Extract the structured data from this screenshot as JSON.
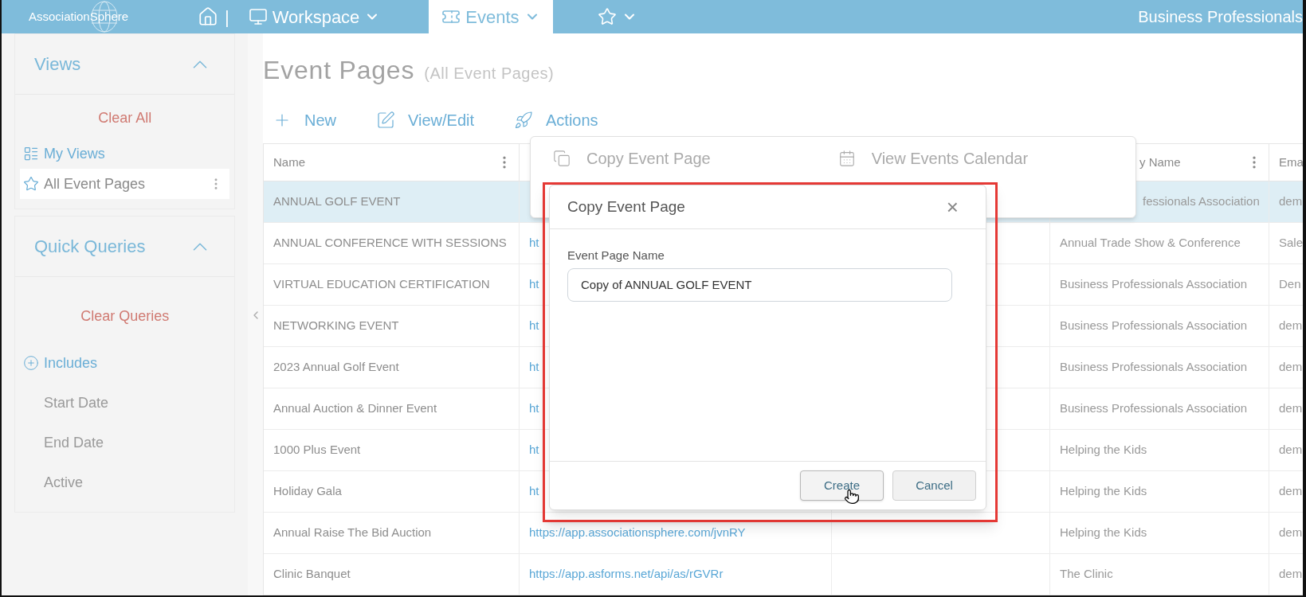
{
  "topbar": {
    "logo": "AssociationSphere",
    "separator": "|",
    "nav": [
      {
        "kind": "workspace",
        "label": "Workspace",
        "selected": false
      },
      {
        "kind": "events",
        "label": "Events",
        "selected": true
      },
      {
        "kind": "favorites",
        "selected": false
      }
    ],
    "organization": "Business Professionals"
  },
  "sidebar": {
    "sections": [
      {
        "title": "Views",
        "expanded": true,
        "clear": "Clear All",
        "items": [
          {
            "kind": "link",
            "label": "My Views",
            "selected": false
          },
          {
            "kind": "view",
            "label": "All Event Pages",
            "selected": true
          }
        ]
      },
      {
        "title": "Quick Queries",
        "expanded": true,
        "clear": "Clear Queries",
        "items": [
          {
            "kind": "add",
            "label": "Includes",
            "selected": false
          },
          {
            "kind": "field",
            "label": "Start Date",
            "selected": false
          },
          {
            "kind": "field",
            "label": "End Date",
            "selected": false
          },
          {
            "kind": "field",
            "label": "Active",
            "selected": false
          }
        ]
      }
    ]
  },
  "page": {
    "title": "Event Pages",
    "subtitle": "(All Event Pages)"
  },
  "toolbar": [
    {
      "kind": "new",
      "label": "New"
    },
    {
      "kind": "edit",
      "label": "View/Edit"
    },
    {
      "kind": "actions",
      "label": "Actions"
    }
  ],
  "actions_menu": [
    {
      "kind": "copy",
      "label": "Copy Event Page"
    },
    {
      "kind": "calendar",
      "label": "View Events Calendar"
    }
  ],
  "table": {
    "columns": [
      {
        "label": "Name",
        "menu": true
      },
      {},
      {},
      {
        "label": "y Name",
        "menu": true,
        "clipped": true
      },
      {
        "label": "Ema"
      }
    ],
    "rows": [
      {
        "selected": true,
        "name": "ANNUAL GOLF EVENT",
        "column_4": "fessionals Association",
        "column_4_clipped": true,
        "column_5": "dem"
      },
      {
        "selected": false,
        "name": "ANNUAL CONFERENCE WITH SESSIONS",
        "url": "ht",
        "column_4": "Annual Trade Show & Conference",
        "column_5": "Sale"
      },
      {
        "selected": false,
        "name": "VIRTUAL EDUCATION CERTIFICATION",
        "url": "ht",
        "column_4": "Business Professionals Association",
        "column_5": "Den"
      },
      {
        "selected": false,
        "name": "NETWORKING EVENT",
        "url": "ht",
        "column_4": "Business Professionals Association",
        "column_5": "dem"
      },
      {
        "selected": false,
        "name": "2023 Annual Golf Event",
        "url": "ht",
        "column_4": "Business Professionals Association",
        "column_5": "dem"
      },
      {
        "selected": false,
        "name": "Annual Auction & Dinner Event",
        "url": "ht",
        "column_4": "Business Professionals Association",
        "column_5": "dem"
      },
      {
        "selected": false,
        "name": "1000 Plus Event",
        "url": "ht",
        "column_4": "Helping the Kids",
        "column_5": "dem"
      },
      {
        "selected": false,
        "name": "Holiday Gala",
        "url": "ht",
        "column_4": "Helping the Kids",
        "column_5": "dem"
      },
      {
        "selected": false,
        "name": "Annual Raise The Bid Auction",
        "url": "https://app.associationsphere.com/jvnRY",
        "column_4": "Helping the Kids",
        "column_5": "dem"
      },
      {
        "selected": false,
        "name": "Clinic Banquet",
        "url": "https://app.asforms.net/api/as/rGVRr",
        "column_4": "The Clinic",
        "column_5": "dem"
      }
    ]
  },
  "dialog": {
    "title": "Copy Event Page",
    "close": "×",
    "field_label": "Event Page Name",
    "field_value": "Copy of ANNUAL GOLF EVENT",
    "buttons": [
      {
        "label": "Create",
        "hovered": true
      },
      {
        "label": "Cancel",
        "hovered": false
      }
    ]
  }
}
